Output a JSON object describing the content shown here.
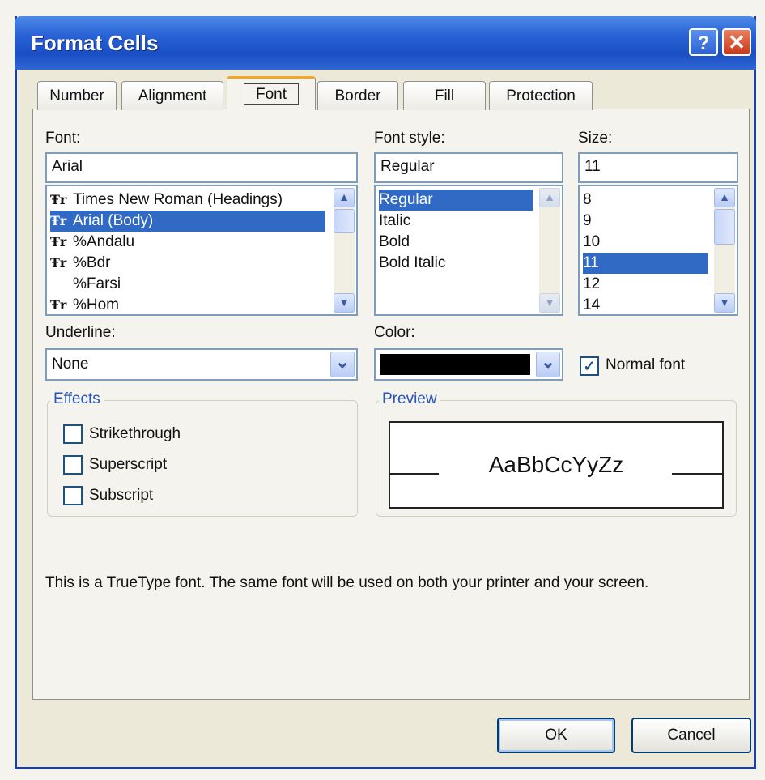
{
  "window": {
    "title": "Format Cells",
    "help_glyph": "?",
    "close_glyph": "✕"
  },
  "tabs": [
    {
      "label": "Number"
    },
    {
      "label": "Alignment"
    },
    {
      "label": "Font"
    },
    {
      "label": "Border"
    },
    {
      "label": "Fill"
    },
    {
      "label": "Protection"
    }
  ],
  "font": {
    "label": "Font:",
    "value": "Arial",
    "list": [
      {
        "label": "Times New Roman (Headings)",
        "truetype": true
      },
      {
        "label": "Arial (Body)",
        "truetype": true,
        "selected": true
      },
      {
        "label": "%Andalu",
        "truetype": true
      },
      {
        "label": "%Bdr",
        "truetype": true
      },
      {
        "label": "%Farsi",
        "truetype": false
      },
      {
        "label": "%Hom",
        "truetype": true
      }
    ],
    "tt_glyph": "Ŧr"
  },
  "font_style": {
    "label": "Font style:",
    "value": "Regular",
    "list": [
      "Regular",
      "Italic",
      "Bold",
      "Bold Italic"
    ],
    "selected": "Regular"
  },
  "size": {
    "label": "Size:",
    "value": "11",
    "list": [
      "8",
      "9",
      "10",
      "11",
      "12",
      "14"
    ],
    "selected": "11"
  },
  "underline": {
    "label": "Underline:",
    "value": "None"
  },
  "color": {
    "label": "Color:",
    "value_color": "#000000"
  },
  "normal_font": {
    "label": "Normal font",
    "checked": true,
    "check_glyph": "✓"
  },
  "effects": {
    "title": "Effects",
    "options": [
      {
        "label": "Strikethrough",
        "checked": false
      },
      {
        "label": "Superscript",
        "checked": false
      },
      {
        "label": "Subscript",
        "checked": false
      }
    ]
  },
  "preview": {
    "title": "Preview",
    "sample": "AaBbCcYyZz"
  },
  "info_text": "This is a TrueType font.  The same font will be used on both your printer and your screen.",
  "buttons": {
    "ok": "OK",
    "cancel": "Cancel"
  },
  "icons": {
    "up": "▲",
    "down": "▼",
    "combo": "⌄"
  }
}
